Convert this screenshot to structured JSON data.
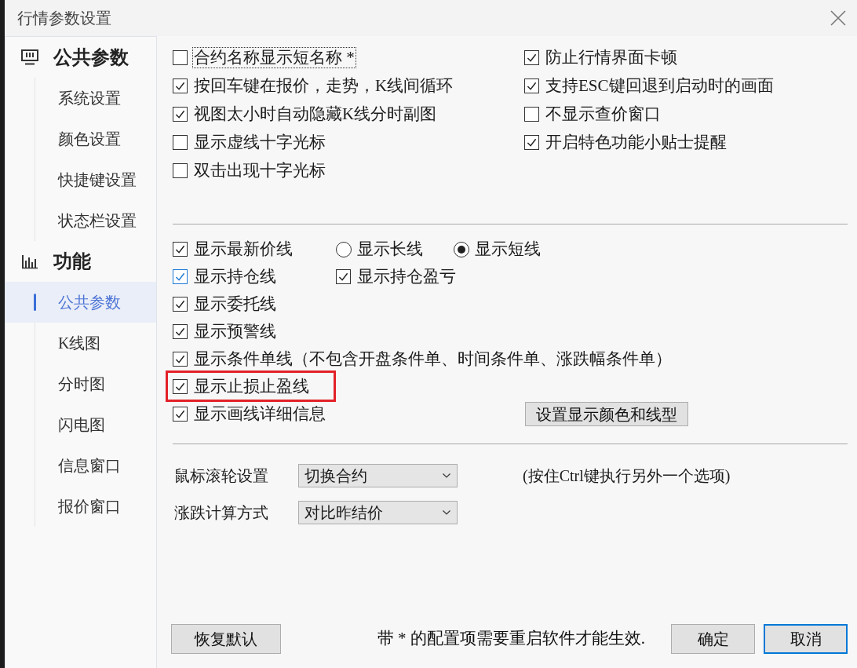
{
  "window": {
    "title": "行情参数设置"
  },
  "sidebar": {
    "sections": [
      {
        "title": "公共参数",
        "items": [
          {
            "label": "系统设置",
            "selected": false
          },
          {
            "label": "颜色设置",
            "selected": false
          },
          {
            "label": "快捷键设置",
            "selected": false
          },
          {
            "label": "状态栏设置",
            "selected": false
          }
        ]
      },
      {
        "title": "功能",
        "items": [
          {
            "label": "公共参数",
            "selected": true
          },
          {
            "label": "K线图",
            "selected": false
          },
          {
            "label": "分时图",
            "selected": false
          },
          {
            "label": "闪电图",
            "selected": false
          },
          {
            "label": "信息窗口",
            "selected": false
          },
          {
            "label": "报价窗口",
            "selected": false
          }
        ]
      }
    ]
  },
  "general_options": {
    "left": [
      {
        "label": "合约名称显示短名称 *",
        "checked": false,
        "focused": true
      },
      {
        "label": "按回车键在报价，走势，K线间循环",
        "checked": true,
        "focused": false
      },
      {
        "label": "视图太小时自动隐藏K线分时副图",
        "checked": true,
        "focused": false
      },
      {
        "label": "显示虚线十字光标",
        "checked": false,
        "focused": false
      },
      {
        "label": "双击出现十字光标",
        "checked": false,
        "focused": false
      }
    ],
    "right": [
      {
        "label": "防止行情界面卡顿",
        "checked": true,
        "focused": false
      },
      {
        "label": "支持ESC键回退到启动时的画面",
        "checked": true,
        "focused": false
      },
      {
        "label": "不显示查价窗口",
        "checked": false,
        "focused": false
      },
      {
        "label": "开启特色功能小贴士提醒",
        "checked": true,
        "focused": false
      }
    ]
  },
  "display_options": [
    {
      "highlighted": false,
      "controls": [
        {
          "kind": "checkbox",
          "label": "显示最新价线",
          "checked": true,
          "hovered": false
        },
        {
          "kind": "radio",
          "label": "显示长线",
          "selected": false
        },
        {
          "kind": "radio",
          "label": "显示短线",
          "selected": true
        }
      ]
    },
    {
      "highlighted": false,
      "controls": [
        {
          "kind": "checkbox",
          "label": "显示持仓线",
          "checked": true,
          "hovered": true
        },
        {
          "kind": "checkbox",
          "label": "显示持仓盈亏",
          "checked": true,
          "hovered": false
        }
      ]
    },
    {
      "highlighted": false,
      "controls": [
        {
          "kind": "checkbox",
          "label": "显示委托线",
          "checked": true,
          "hovered": false
        }
      ]
    },
    {
      "highlighted": false,
      "controls": [
        {
          "kind": "checkbox",
          "label": "显示预警线",
          "checked": true,
          "hovered": false
        }
      ]
    },
    {
      "highlighted": false,
      "controls": [
        {
          "kind": "checkbox",
          "label": "显示条件单线（不包含开盘条件单、时间条件单、涨跌幅条件单）",
          "checked": true,
          "hovered": false
        }
      ]
    },
    {
      "highlighted": true,
      "controls": [
        {
          "kind": "checkbox",
          "label": "显示止损止盈线",
          "checked": true,
          "hovered": false
        }
      ]
    },
    {
      "highlighted": false,
      "controls": [
        {
          "kind": "checkbox",
          "label": "显示画线详细信息",
          "checked": true,
          "hovered": false
        },
        {
          "kind": "button",
          "label": "设置显示颜色和线型"
        }
      ]
    }
  ],
  "dropdowns": [
    {
      "label": "鼠标滚轮设置",
      "value": "切换合约",
      "note": "(按住Ctrl键执行另外一个选项)"
    },
    {
      "label": "涨跌计算方式",
      "value": "对比昨结价"
    }
  ],
  "footer": {
    "reset_button": "恢复默认",
    "note": "带 * 的配置项需要重启软件才能生效.",
    "buttons": [
      {
        "label": "确定",
        "focused": false
      },
      {
        "label": "取消",
        "focused": true
      }
    ]
  }
}
